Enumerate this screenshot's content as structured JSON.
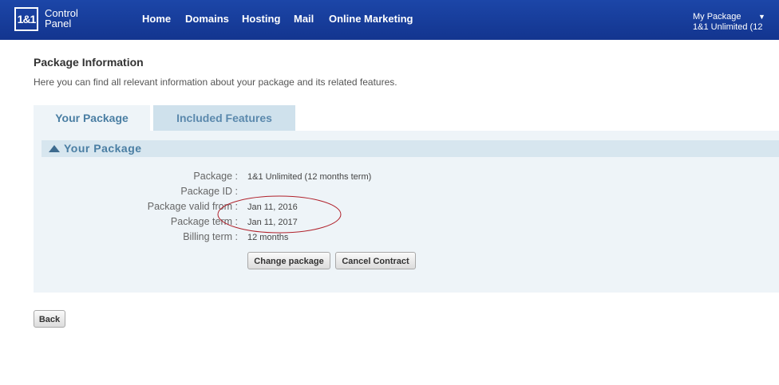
{
  "header": {
    "logo_text": "1&1",
    "app_title_line1": "Control",
    "app_title_line2": "Panel",
    "nav": [
      "Home",
      "Domains",
      "Hosting",
      "Mail",
      "Online Marketing"
    ],
    "account_label": "My Package",
    "account_value": "1&1 Unlimited (12",
    "account_arrow": "▼"
  },
  "page": {
    "title": "Package Information",
    "subtitle": "Here you can find all relevant information about your package and its related features."
  },
  "tabs": [
    {
      "label": "Your Package",
      "active": true
    },
    {
      "label": "Included Features",
      "active": false
    }
  ],
  "section": {
    "title": "Your Package",
    "rows": [
      {
        "label": "Package :",
        "value": "1&1 Unlimited (12 months term)"
      },
      {
        "label": "Package ID :",
        "value": ""
      },
      {
        "label": "Package valid from :",
        "value": "Jan 11, 2016"
      },
      {
        "label": "Package term :",
        "value": "Jan 11, 2017"
      },
      {
        "label": "Billing term :",
        "value": "12 months"
      }
    ],
    "buttons": {
      "change": "Change package",
      "cancel": "Cancel Contract"
    }
  },
  "back_label": "Back",
  "colors": {
    "header": "#1c46a8",
    "annotation": "#b0202a",
    "tab_text": "#4a7ea3"
  }
}
